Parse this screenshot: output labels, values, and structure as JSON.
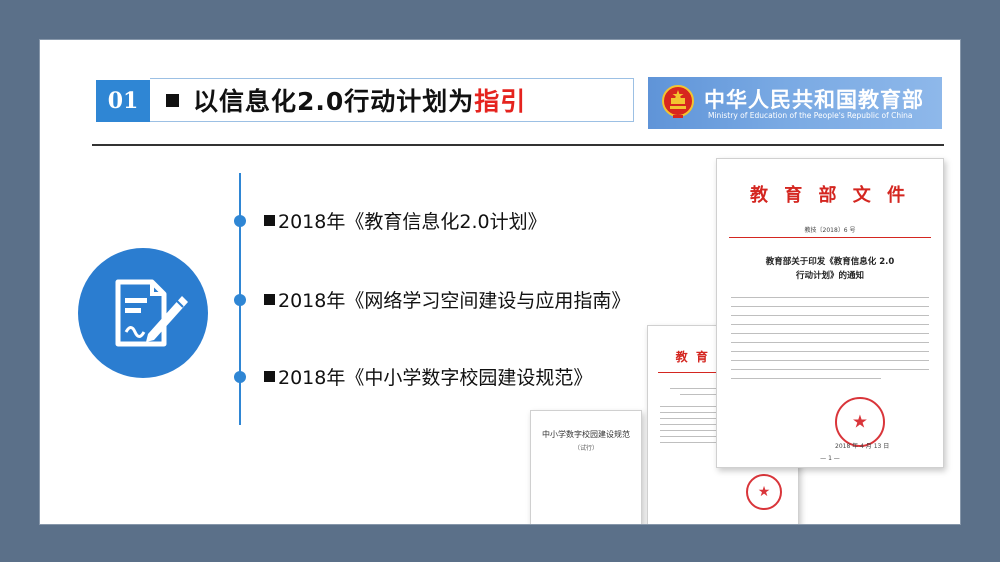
{
  "header": {
    "number": "01",
    "title_main": "以信息化2.0行动计划为",
    "title_highlight": "指引",
    "accent_color": "#2f86d4",
    "highlight_color": "#e5231e"
  },
  "ministry_banner": {
    "name_cn": "中华人民共和国教育部",
    "name_en": "Ministry of Education of the People's Republic of China",
    "logo_icon": "national-emblem-icon"
  },
  "timeline": {
    "items": [
      {
        "label": "2018年《教育信息化2.0计划》"
      },
      {
        "label": "2018年《网络学习空间建设与应用指南》"
      },
      {
        "label": "2018年《中小学数字校园建设规范》"
      }
    ]
  },
  "feature_icon": "document-pen-icon",
  "documents": {
    "large": {
      "header": "教 育 部 文 件",
      "doc_number": "教技〔2018〕6 号",
      "title_line1": "教育部关于印发《教育信息化 2.0",
      "title_line2": "行动计划》的通知",
      "date": "2018 年 4 月 13 日",
      "page": "— 1 —"
    },
    "medium": {
      "header": "教 育 部 文 件"
    },
    "small": {
      "title": "中小学数字校园建设规范",
      "subtitle": "（试行）"
    }
  }
}
